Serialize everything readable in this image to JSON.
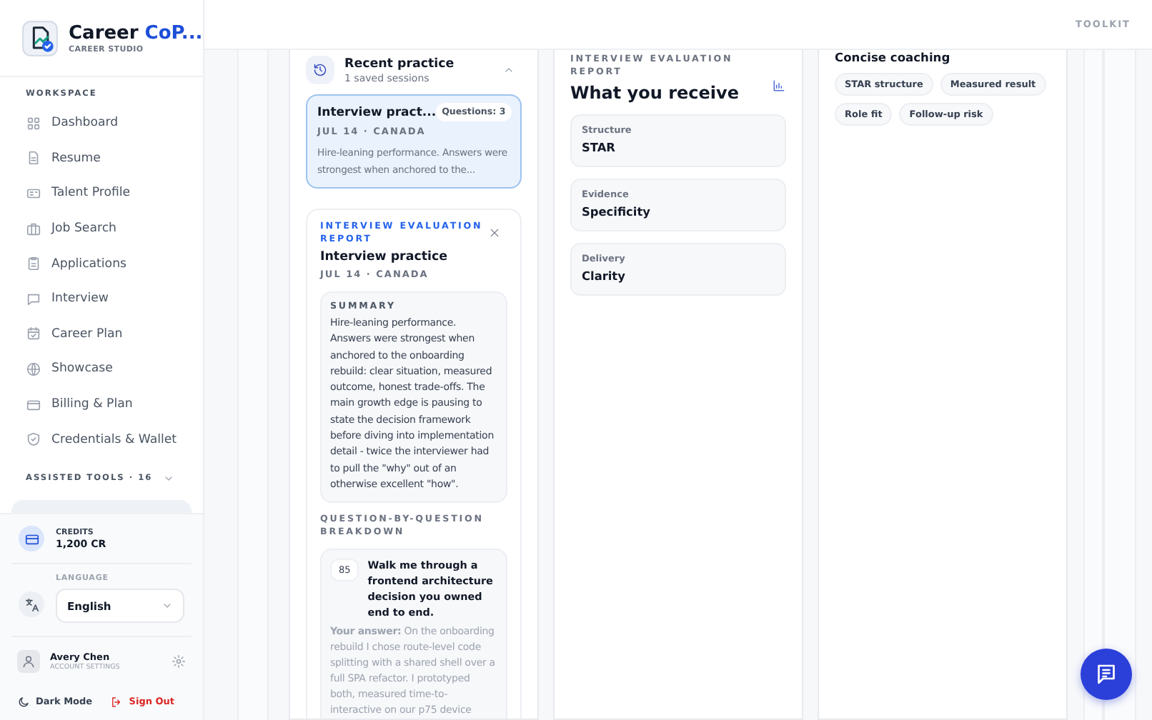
{
  "sidebar": {
    "brand": {
      "name": "Career",
      "accent": "CoP...",
      "subtitle": "CAREER STUDIO"
    },
    "section_title": "WORKSPACE",
    "items": [
      {
        "label": "Dashboard",
        "selected": false
      },
      {
        "label": "Resume",
        "selected": false
      },
      {
        "label": "Talent Profile",
        "selected": false
      },
      {
        "label": "Job Search",
        "selected": false
      },
      {
        "label": "Applications",
        "selected": false
      },
      {
        "label": "Interview",
        "selected": false
      },
      {
        "label": "Career Plan",
        "selected": false
      },
      {
        "label": "Showcase",
        "selected": false
      },
      {
        "label": "Billing & Plan",
        "selected": false
      },
      {
        "label": "Credentials & Wallet",
        "selected": false
      }
    ],
    "assisted_tools": "ASSISTED TOOLS · 16",
    "credits": {
      "label": "CREDITS",
      "value": "1,200 CR"
    },
    "language": {
      "label": "LANGUAGE",
      "value": "English"
    },
    "account": {
      "name": "Avery Chen",
      "subtitle": "ACCOUNT SETTINGS"
    },
    "dark_mode": "Dark Mode",
    "sign_out": "Sign Out"
  },
  "top_bar": {
    "label": "TOOLKIT"
  },
  "recent_practice": {
    "title": "Recent practice",
    "subtitle": "1 saved sessions",
    "sessions": [
      {
        "title": "Interview pract...",
        "badge": "Questions: 3",
        "meta": "JUL 14 · CANADA",
        "snippet": "Hire-leaning performance. Answers were strongest when anchored to the...",
        "selected": true
      }
    ]
  },
  "report": {
    "eyebrow": "INTERVIEW EVALUATION REPORT",
    "title": "Interview practice",
    "meta": "JUL 14 · CANADA",
    "summary_label": "SUMMARY",
    "summary": "Hire-leaning performance. Answers were strongest when anchored to the onboarding rebuild: clear situation, measured outcome, honest trade-offs. The main growth edge is pausing to state the decision framework before diving into implementation detail - twice the interviewer had to pull the \"why\" out of an otherwise excellent \"how\".",
    "breakdown_label": "QUESTION-BY-QUESTION BREAKDOWN",
    "questions": [
      {
        "score": "85",
        "question": "Walk me through a frontend architecture decision you owned end to end.",
        "answer": "**Your answer:** On the onboarding rebuild I chose route-level code splitting with a shared shell over a full SPA refactor. I prototyped both, measured time-to-interactive on our p75 device"
      }
    ]
  },
  "deliverables": {
    "eyebrow": "INTERVIEW EVALUATION REPORT",
    "title": "What you receive",
    "items": [
      {
        "label": "Structure",
        "value": "STAR"
      },
      {
        "label": "Evidence",
        "value": "Specificity"
      },
      {
        "label": "Delivery",
        "value": "Clarity"
      }
    ]
  },
  "coaching": {
    "title": "Concise coaching",
    "tags": [
      "STAR structure",
      "Measured result",
      "Role fit",
      "Follow-up risk"
    ]
  }
}
